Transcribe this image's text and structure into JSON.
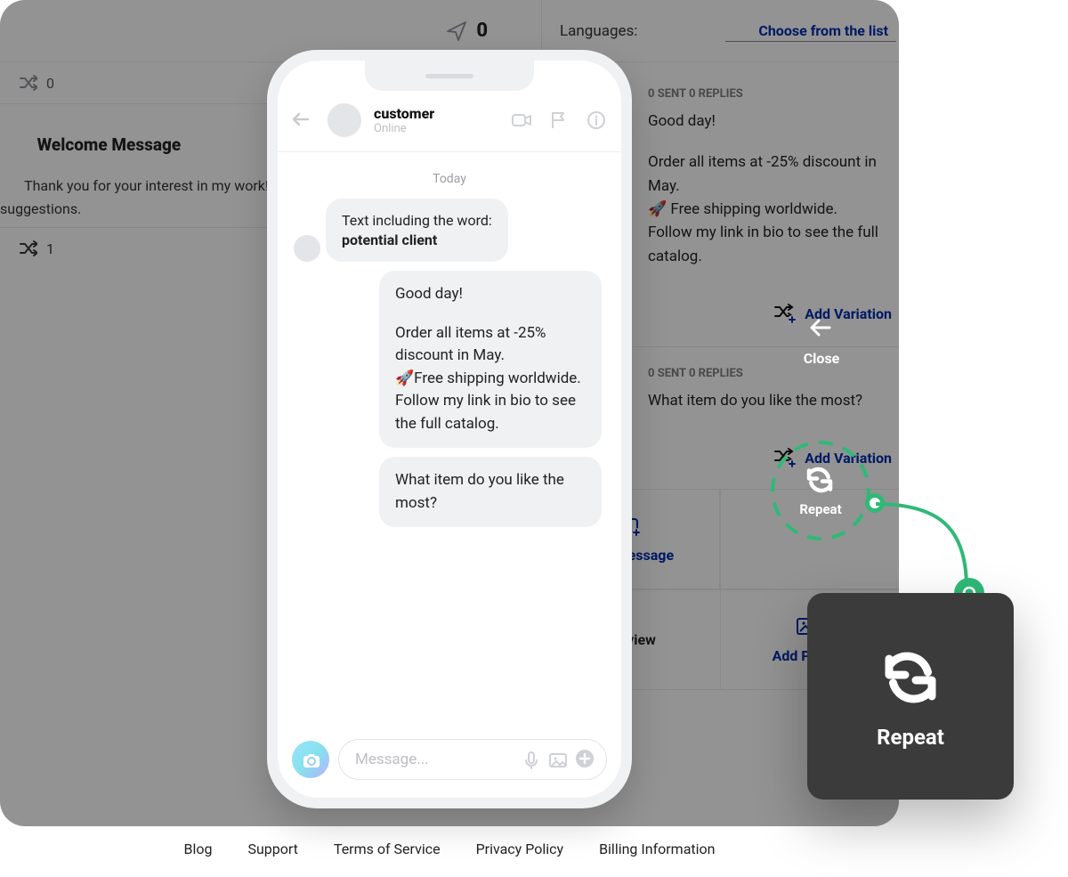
{
  "top": {
    "sent_count": "0",
    "languages_label": "Languages:",
    "choose_label": "Choose from the list"
  },
  "left": {
    "shuffle1_count": "0",
    "welcome_title": "Welcome Message",
    "welcome_body": "Thank you for your interest in my work! Feel free to ask any questions or suggestions.",
    "shuffle2_count": "1"
  },
  "messages": [
    {
      "sent_replies": "0 SENT   0 REPLIES",
      "body_line1": "Good day!",
      "body_para": "Order all items at -25% discount in May.",
      "body_line3": "🚀 Free shipping worldwide.",
      "body_line4": "Follow my link in bio to see the full catalog.",
      "add_variation": "Add Variation"
    },
    {
      "sent_replies": "0 SENT   0 REPLIES",
      "body": "What item do you like the most?",
      "add_variation": "Add Variation"
    }
  ],
  "actions": {
    "add_message": "Add Message",
    "preview": "Preview",
    "add_picture": "Add Picture"
  },
  "phone": {
    "name": "customer",
    "status": "Online",
    "today": "Today",
    "incoming_line1": "Text including the word:",
    "incoming_line2": "potential client",
    "out1_line1": "Good day!",
    "out1_line2": "Order all items at -25% discount in May.",
    "out1_line3": "🚀Free shipping worldwide.",
    "out1_line4": "Follow my link in bio to see the full catalog.",
    "out2": "What item do you like the most?",
    "input_placeholder": "Message..."
  },
  "overlays": {
    "close": "Close",
    "repeat": "Repeat",
    "repeat_big": "Repeat"
  },
  "footer": {
    "blog": "Blog",
    "support": "Support",
    "tos": "Terms of Service",
    "privacy": "Privacy Policy",
    "billing": "Billing Information"
  }
}
